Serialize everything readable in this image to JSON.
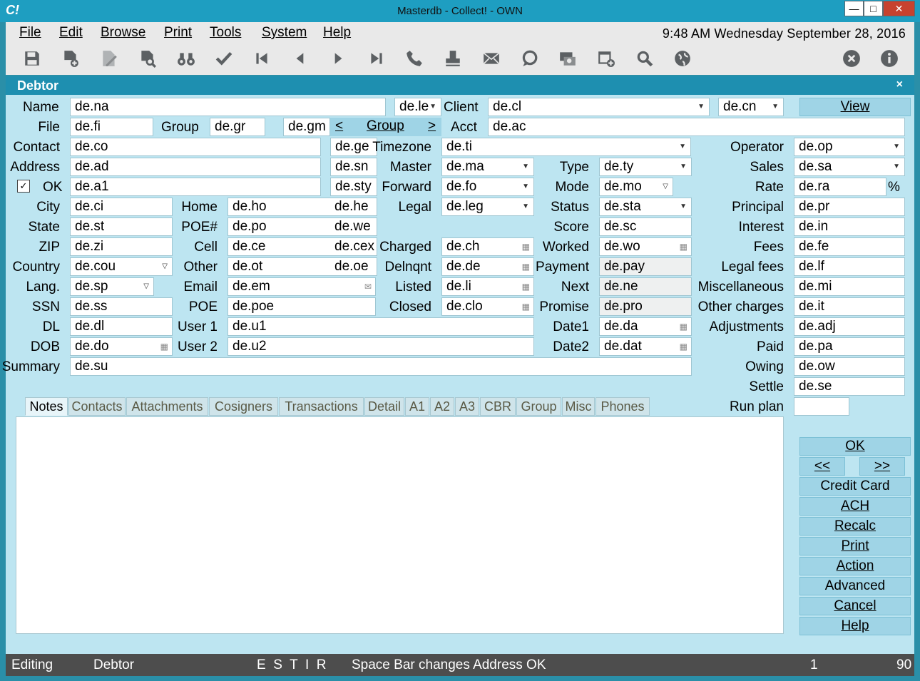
{
  "app": {
    "logo": "C!",
    "title": "Masterdb - Collect! - OWN"
  },
  "window_controls": {
    "minimize": "—",
    "maximize": "□",
    "close": "✕"
  },
  "menu": [
    "File",
    "Edit",
    "Browse",
    "Print",
    "Tools",
    "System",
    "Help"
  ],
  "clock": "9:48 AM  Wednesday  September 28, 2016",
  "toolbar": [
    {
      "icon": "save-icon"
    },
    {
      "icon": "new-record-icon"
    },
    {
      "icon": "edit-record-icon"
    },
    {
      "icon": "find-record-icon"
    },
    {
      "icon": "binoculars-icon"
    },
    {
      "icon": "checkmark-icon"
    },
    {
      "icon": "first-record-icon"
    },
    {
      "icon": "previous-record-icon"
    },
    {
      "icon": "next-record-icon"
    },
    {
      "icon": "last-record-icon"
    },
    {
      "icon": "phone-icon"
    },
    {
      "icon": "print-stamp-icon"
    },
    {
      "icon": "envelope-icon"
    },
    {
      "icon": "chat-bubble-icon"
    },
    {
      "icon": "credit-card-icon"
    },
    {
      "icon": "calendar-add-icon"
    },
    {
      "icon": "search-icon"
    },
    {
      "icon": "globe-icon"
    },
    {
      "icon": "close-circle-icon"
    },
    {
      "icon": "info-icon"
    }
  ],
  "form": {
    "title": "Debtor",
    "close": "×",
    "labels": {
      "name": "Name",
      "client": "Client",
      "file": "File",
      "group": "Group",
      "acct": "Acct",
      "contact": "Contact",
      "timezone": "Timezone",
      "operator": "Operator",
      "address": "Address",
      "master": "Master",
      "type": "Type",
      "sales": "Sales",
      "ok": "OK",
      "forward": "Forward",
      "mode": "Mode",
      "rate": "Rate",
      "percent": "%",
      "city": "City",
      "home": "Home",
      "legal": "Legal",
      "status": "Status",
      "principal": "Principal",
      "state": "State",
      "poe_hash": "POE#",
      "score": "Score",
      "interest": "Interest",
      "zip": "ZIP",
      "cell": "Cell",
      "charged": "Charged",
      "worked": "Worked",
      "fees": "Fees",
      "country": "Country",
      "other": "Other",
      "delinquent": "Delnqnt",
      "payment": "Payment",
      "legal_fees": "Legal fees",
      "lang": "Lang.",
      "email": "Email",
      "listed": "Listed",
      "next": "Next",
      "misc": "Miscellaneous",
      "ssn": "SSN",
      "poe": "POE",
      "closed": "Closed",
      "promise": "Promise",
      "other_charges": "Other charges",
      "dl": "DL",
      "user1": "User 1",
      "date1": "Date1",
      "adjustments": "Adjustments",
      "dob": "DOB",
      "user2": "User 2",
      "date2": "Date2",
      "paid": "Paid",
      "summary": "Summary",
      "owing": "Owing",
      "settle": "Settle",
      "run_plan": "Run plan"
    },
    "values": {
      "name": "de.na",
      "le": "de.le",
      "client": "de.cl",
      "cn": "de.cn",
      "file": "de.fi",
      "group": "de.gr",
      "gm": "de.gm",
      "acct": "de.ac",
      "contact": "de.co",
      "ge": "de.ge",
      "timezone": "de.ti",
      "operator": "de.op",
      "address": "de.ad",
      "sn": "de.sn",
      "master": "de.ma",
      "type": "de.ty",
      "sales": "de.sa",
      "a1": "de.a1",
      "sty": "de.sty",
      "forward": "de.fo",
      "mode": "de.mo",
      "rate": "de.ra",
      "city": "de.ci",
      "home": "de.ho",
      "he": "de.he",
      "legal": "de.leg",
      "status": "de.sta",
      "principal": "de.pr",
      "state": "de.st",
      "poe_hash": "de.po",
      "we": "de.we",
      "score": "de.sc",
      "interest": "de.in",
      "zip": "de.zi",
      "cell": "de.ce",
      "cex": "de.cex",
      "charged": "de.ch",
      "worked": "de.wo",
      "fees": "de.fe",
      "country": "de.cou",
      "other": "de.ot",
      "oe": "de.oe",
      "delinquent": "de.de",
      "payment": "de.pay",
      "legal_fees": "de.lf",
      "lang": "de.sp",
      "email": "de.em",
      "listed": "de.li",
      "next": "de.ne",
      "misc": "de.mi",
      "ssn": "de.ss",
      "poe": "de.poe",
      "closed": "de.clo",
      "promise": "de.pro",
      "other_charges": "de.it",
      "dl": "de.dl",
      "user1": "de.u1",
      "date1": "de.da",
      "adjustments": "de.adj",
      "dob": "de.do",
      "user2": "de.u2",
      "date2": "de.dat",
      "paid": "de.pa",
      "summary": "de.su",
      "owing": "de.ow",
      "settle": "de.se",
      "run_plan": ""
    },
    "group_nav": {
      "prev": "<",
      "label": "Group",
      "next": ">"
    },
    "ok_checked": true,
    "view_button": "View"
  },
  "tabs": [
    "Notes",
    "Contacts",
    "Attachments",
    "Cosigners",
    "Transactions",
    "Detail",
    "A1",
    "A2",
    "A3",
    "CBR",
    "Group",
    "Misc",
    "Phones"
  ],
  "buttons": {
    "ok": "OK",
    "prev": "<<",
    "next": ">>",
    "credit_card": "Credit Card",
    "ach": "ACH",
    "recalc": "Recalc",
    "print": "Print",
    "action": "Action",
    "advanced": "Advanced",
    "cancel": "Cancel",
    "help": "Help"
  },
  "status": {
    "mode": "Editing",
    "form": "Debtor",
    "flags": "E  S  T  I  R",
    "message": "Space Bar changes Address OK",
    "record": "1",
    "count": "90"
  },
  "colors": {
    "title_bar": "#1e9ec1",
    "form_header": "#1e8fb0",
    "form_bg": "#bde5f1",
    "button": "#9fd4e6",
    "status_bar": "#4d4d4d",
    "close_button": "#c7422f"
  }
}
